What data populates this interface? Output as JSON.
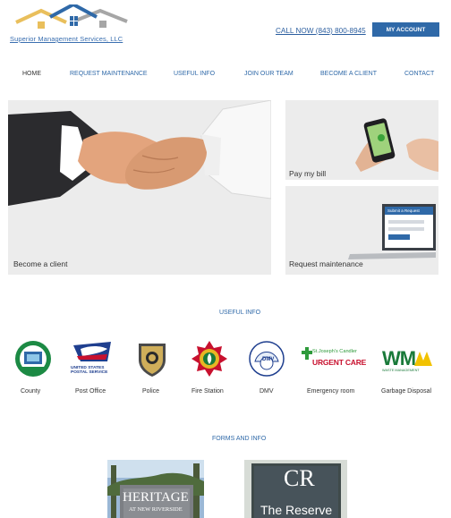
{
  "header": {
    "company_name": "Superior Management Services, LLC",
    "call_now": "CALL NOW (843) 800-8945",
    "account_button": "MY ACCOUNT"
  },
  "nav": {
    "items": [
      "HOME",
      "REQUEST MAINTENANCE",
      "USEFUL INFO",
      "JOIN OUR TEAM",
      "BECOME A CLIENT",
      "CONTACT"
    ],
    "active": "HOME"
  },
  "tiles": {
    "become_client": "Become a client",
    "pay_bill": "Pay my bill",
    "request_maintenance": "Request maintenance",
    "laptop_screen_text": "Submit a Request"
  },
  "useful_info": {
    "title": "USEFUL INFO",
    "items": [
      {
        "label": "County",
        "icon": "county-seal-icon"
      },
      {
        "label": "Post Office",
        "icon": "usps-eagle-icon"
      },
      {
        "label": "Police",
        "icon": "police-badge-icon"
      },
      {
        "label": "Fire Station",
        "icon": "fire-department-icon"
      },
      {
        "label": "DMV",
        "icon": "dmv-logo-icon"
      },
      {
        "label": "Emergency room",
        "icon": "urgent-care-icon"
      },
      {
        "label": "Garbage Disposal",
        "icon": "waste-management-icon"
      }
    ]
  },
  "logos_text": {
    "usps_line1": "UNITED STATES",
    "usps_line2": "POSTAL SERVICE",
    "dmv": "DMV",
    "urgent_brand": "St.Joseph's Candler",
    "urgent_care": "URGENT CARE",
    "wm": "WM",
    "wm_sub": "WASTE MANAGEMENT"
  },
  "forms": {
    "title": "FORMS AND INFO",
    "card1_title": "HERITAGE",
    "card1_sub": "AT NEW RIVERSIDE",
    "card2_title": "CR",
    "card2_sub": "The Reserve"
  },
  "colors": {
    "brand_blue": "#2f69a8",
    "roof_gold": "#e9bf5c",
    "roof_blue": "#2f69a8",
    "roof_gray": "#a6a6a6"
  }
}
